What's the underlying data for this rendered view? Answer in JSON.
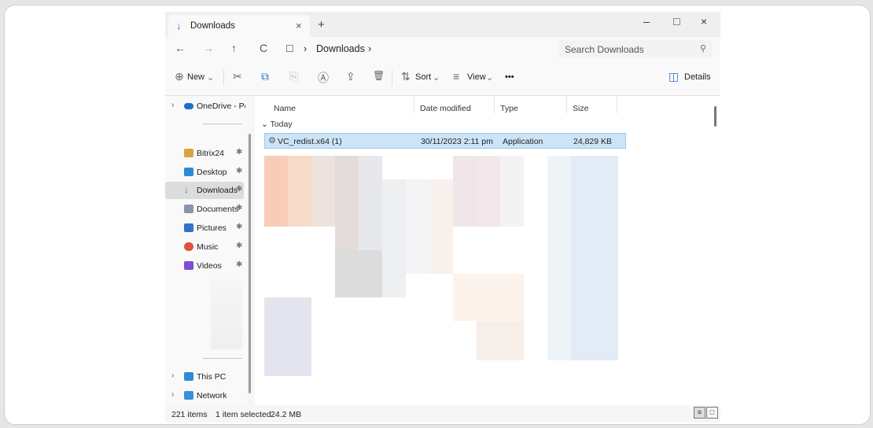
{
  "tab": {
    "title": "Downloads",
    "close": "×",
    "new_tab": "+",
    "dl_glyph": "↓"
  },
  "window_controls": {
    "minimize": "–",
    "maximize": "□",
    "close": "×"
  },
  "nav": {
    "back": "←",
    "forward": "→",
    "up": "↑",
    "refresh": "C",
    "monitor": "□",
    "sep1": "›",
    "sep2": "›"
  },
  "address": {
    "crumb": "Downloads"
  },
  "search": {
    "placeholder": "Search Downloads",
    "icon": "⚲"
  },
  "toolbar": {
    "new_label": "New",
    "new_icon": "⊕",
    "cut_icon": "✂",
    "copy_icon": "⧉",
    "paste_icon": "⎘",
    "rename_icon": "Ⓐ",
    "share_icon": "⇪",
    "delete_icon": "🗑",
    "sort_label": "Sort",
    "sort_icon": "⇅",
    "view_label": "View",
    "view_icon": "≡",
    "more": "•••",
    "details_label": "Details",
    "details_icon": "◫",
    "dropdown": "⌄"
  },
  "sidebar": {
    "onedrive": "OneDrive - Perso",
    "items": [
      {
        "label": "Bitrix24",
        "pin": "✱",
        "color": "#d9a441"
      },
      {
        "label": "Desktop",
        "pin": "✱",
        "color": "#2c8ad8"
      },
      {
        "label": "Downloads",
        "pin": "✱",
        "color": "#2a7ad5"
      },
      {
        "label": "Documents",
        "pin": "✱",
        "color": "#8795a8"
      },
      {
        "label": "Pictures",
        "pin": "✱",
        "color": "#2f73c9"
      },
      {
        "label": "Music",
        "pin": "✱",
        "color": "#e0533b"
      },
      {
        "label": "Videos",
        "pin": "✱",
        "color": "#7a4fd0"
      }
    ],
    "this_pc": "This PC",
    "network": "Network",
    "chevron": "›"
  },
  "columns": {
    "name": "Name",
    "date": "Date modified",
    "type": "Type",
    "size": "Size"
  },
  "group": {
    "label": "Today",
    "chevron": "⌄"
  },
  "file": {
    "name": "VC_redist.x64 (1)",
    "date": "30/11/2023 2:11 pm",
    "type": "Application",
    "size": "24,829 KB"
  },
  "status": {
    "count": "221 items",
    "selection": "1 item selected",
    "size": "24.2 MB"
  }
}
